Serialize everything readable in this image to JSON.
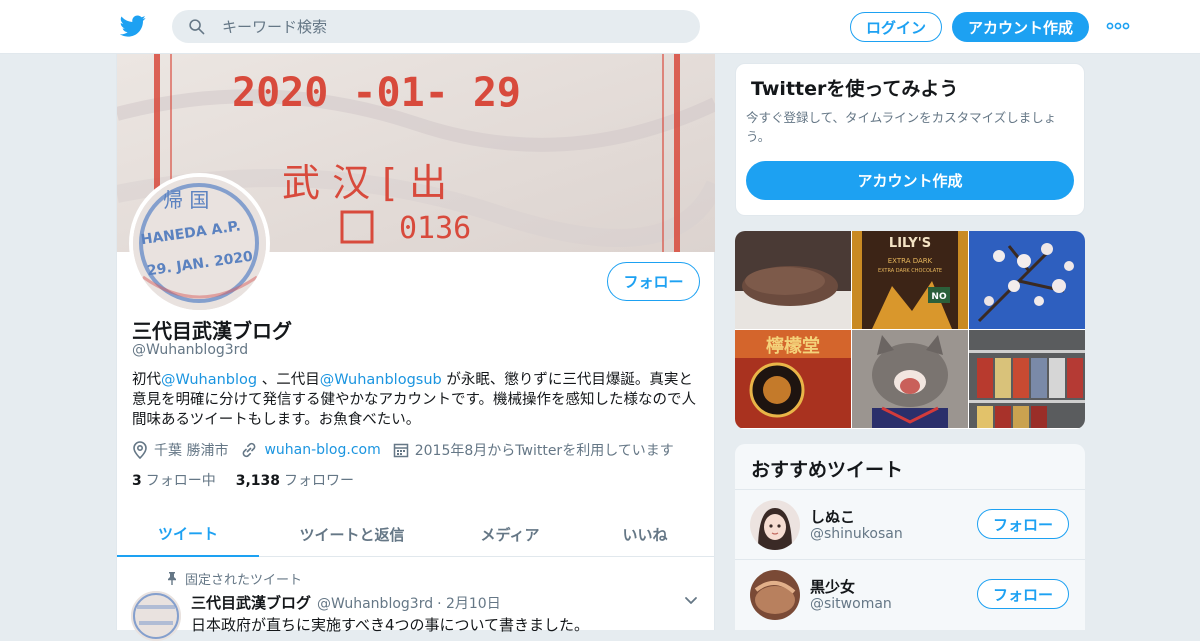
{
  "header": {
    "search_placeholder": "キーワード検索",
    "login_label": "ログイン",
    "signup_label": "アカウント作成",
    "brand_color": "#1da1f2"
  },
  "banner": {
    "stamp_date": "2020 -01- 29",
    "stamp_city": "武 汉 [ 出",
    "stamp_number": "0136"
  },
  "avatar": {
    "stamp_top": "帰 国",
    "stamp_airport": "HANEDA A.P.",
    "stamp_date": "29. JAN. 2020"
  },
  "profile": {
    "follow_label": "フォロー",
    "name": "三代目武漢ブログ",
    "handle": "@Wuhanblog3rd",
    "bio": {
      "p1": "初代",
      "link1": "@Wuhanblog",
      "p2": " 、二代目",
      "link2": "@Wuhanblogsub",
      "p3": " が永眠、懲りずに三代目爆誕。真実と意見を明確に分けて発信する健やかなアカウントです。機械操作を感知した様なので人間味あるツイートもします。お魚食べたい。"
    },
    "location": "千葉 勝浦市",
    "website": "wuhan-blog.com",
    "joined": "2015年8月からTwitterを利用しています",
    "following_count": "3",
    "following_label": "フォロー中",
    "followers_count": "3,138",
    "followers_label": "フォロワー"
  },
  "tabs": [
    {
      "label": "ツイート",
      "active": true
    },
    {
      "label": "ツイートと返信",
      "active": false
    },
    {
      "label": "メディア",
      "active": false
    },
    {
      "label": "いいね",
      "active": false
    }
  ],
  "pinned_tweet": {
    "pinned_label": "固定されたツイート",
    "name": "三代目武漢ブログ",
    "handle": "@Wuhanblog3rd",
    "date": "· 2月10日",
    "text": "日本政府が直ちに実施すべき4つの事について書きました。"
  },
  "signup_card": {
    "title": "Twitterを使ってみよう",
    "desc": "今すぐ登録して、タイムラインをカスタマイズしましょう。",
    "button": "アカウント作成"
  },
  "media_grid": {
    "chocolate_brand": "LILY'S",
    "chocolate_text": "EXTRA DARK",
    "chocolate_sub": "EXTRA DARK CHOCOLATE",
    "chocolate_badge": "NO",
    "drink_label": "檸檬堂"
  },
  "recommended": {
    "title": "おすすめツイート",
    "follow_label": "フォロー",
    "users": [
      {
        "name": "しぬこ",
        "handle": "@shinukosan"
      },
      {
        "name": "黒少女",
        "handle": "@sitwoman"
      }
    ]
  }
}
